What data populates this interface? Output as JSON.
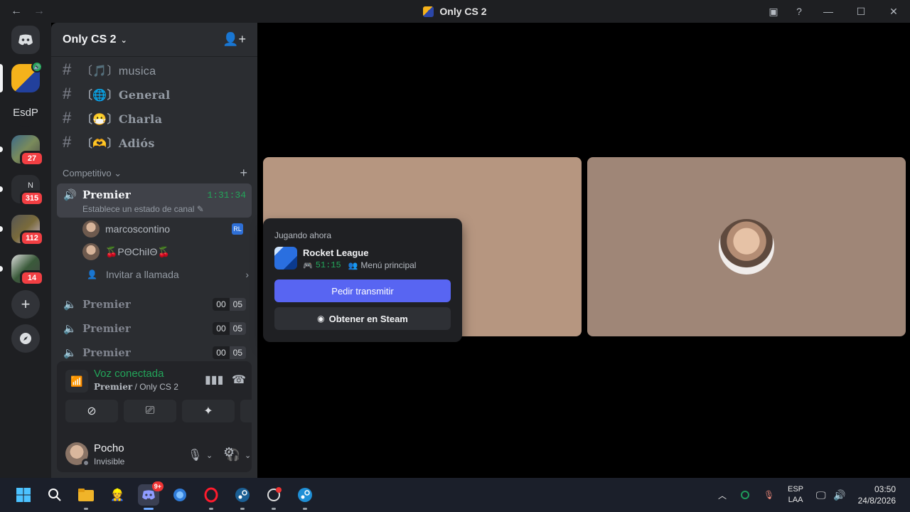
{
  "window": {
    "title": "Only CS 2",
    "back_glyph": "←",
    "forward_glyph": "→"
  },
  "rail": {
    "servers": [
      {
        "name": "home",
        "icon": "discord-icon"
      },
      {
        "name": "Only CS 2",
        "icon": "only-cs2-server-icon",
        "voice_active": true
      },
      {
        "name": "EsdP",
        "label": "EsdP"
      },
      {
        "name": "group-1",
        "badge": "27"
      },
      {
        "name": "group-2",
        "badge": "315",
        "letter": "N"
      },
      {
        "name": "group-3",
        "badge": "112"
      },
      {
        "name": "group-4",
        "badge": "14"
      }
    ],
    "add_server_icon": "plus-icon",
    "explore_icon": "compass-icon"
  },
  "sidebar": {
    "server_name": "Only CS 2",
    "text_channels": [
      {
        "emoji": "🎵",
        "name": "musica",
        "label": "〔🎵〕musica"
      },
      {
        "emoji": "🌐",
        "name": "General",
        "label": "〔🌐〕General"
      },
      {
        "emoji": "😷",
        "name": "Charla",
        "label": "〔😷〕Charla"
      },
      {
        "emoji": "🫶",
        "name": "Adiós",
        "label": "〔🫶〕Adiós"
      }
    ],
    "category": "Competitivo",
    "active_voice": {
      "name": "Premier",
      "timer": "1:31:34",
      "status_placeholder": "Establece un estado de canal"
    },
    "members": [
      {
        "name": "marcoscontino",
        "game_icon": "rocket-league-icon"
      },
      {
        "name": "🍒PΘChiΙΘ🍒"
      }
    ],
    "invite_label": "Invitar a llamada",
    "voice_channels": [
      {
        "name": "Premier",
        "count": "00",
        "limit": "05"
      },
      {
        "name": "Premier",
        "count": "00",
        "limit": "05"
      },
      {
        "name": "Premier",
        "count": "00",
        "limit": "05"
      }
    ]
  },
  "voice_panel": {
    "title": "Voz conectada",
    "channel": "Premier",
    "server": "Only CS 2",
    "separator": " / "
  },
  "user": {
    "name": "Pocho",
    "status": "Invisible"
  },
  "activity_popup": {
    "heading": "Jugando ahora",
    "game": "Rocket League",
    "elapsed": "51:15",
    "detail": "Menú principal",
    "primary_button": "Pedir transmitir",
    "secondary_button": "Obtener en Steam"
  },
  "taskbar": {
    "discord_badge": "9+",
    "language": "ESP",
    "layout": "LAA",
    "time": "03:50",
    "date": "24/8/2026"
  },
  "colors": {
    "accent": "#5865f2",
    "online_green": "#23a55a",
    "badge_red": "#f23f43"
  }
}
